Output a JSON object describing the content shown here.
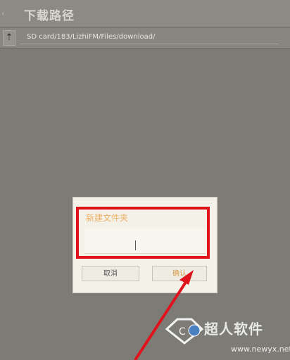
{
  "header": {
    "title": "下载路径",
    "back_icon": "chevron-left-icon"
  },
  "path_bar": {
    "up_icon": "arrow-up-icon",
    "path": "SD card/183/LizhiFM/Files/download/"
  },
  "dialog": {
    "title": "新建文件夹",
    "input_value": "",
    "cancel_label": "取消",
    "ok_label": "确认"
  },
  "overlay": {
    "highlight_color": "#e0121b",
    "arrow_color": "#e0121b"
  },
  "watermark": {
    "name": "超人软件",
    "url": "www.newyx.net"
  }
}
